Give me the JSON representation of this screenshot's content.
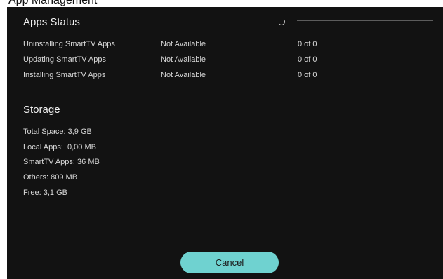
{
  "window": {
    "title": "App Management"
  },
  "apps_status": {
    "title": "Apps Status",
    "rows": [
      {
        "name": "Uninstalling SmartTV Apps",
        "state": "Not Available",
        "count": "0 of 0"
      },
      {
        "name": "Updating SmartTV Apps",
        "state": "Not Available",
        "count": "0 of 0"
      },
      {
        "name": "Installing SmartTV Apps",
        "state": "Not Available",
        "count": "0 of 0"
      }
    ]
  },
  "storage": {
    "title": "Storage",
    "lines": [
      "Total Space: 3,9 GB",
      "Local Apps:  0,00 MB",
      "SmartTV Apps: 36 MB",
      "Others: 809 MB",
      "Free: 3,1 GB"
    ]
  },
  "actions": {
    "cancel_label": "Cancel"
  },
  "colors": {
    "panel_background": "#121212",
    "accent": "#6fd2d0",
    "text": "#d8d8d8"
  },
  "icons": {
    "loading": "loading-spinner-icon"
  }
}
